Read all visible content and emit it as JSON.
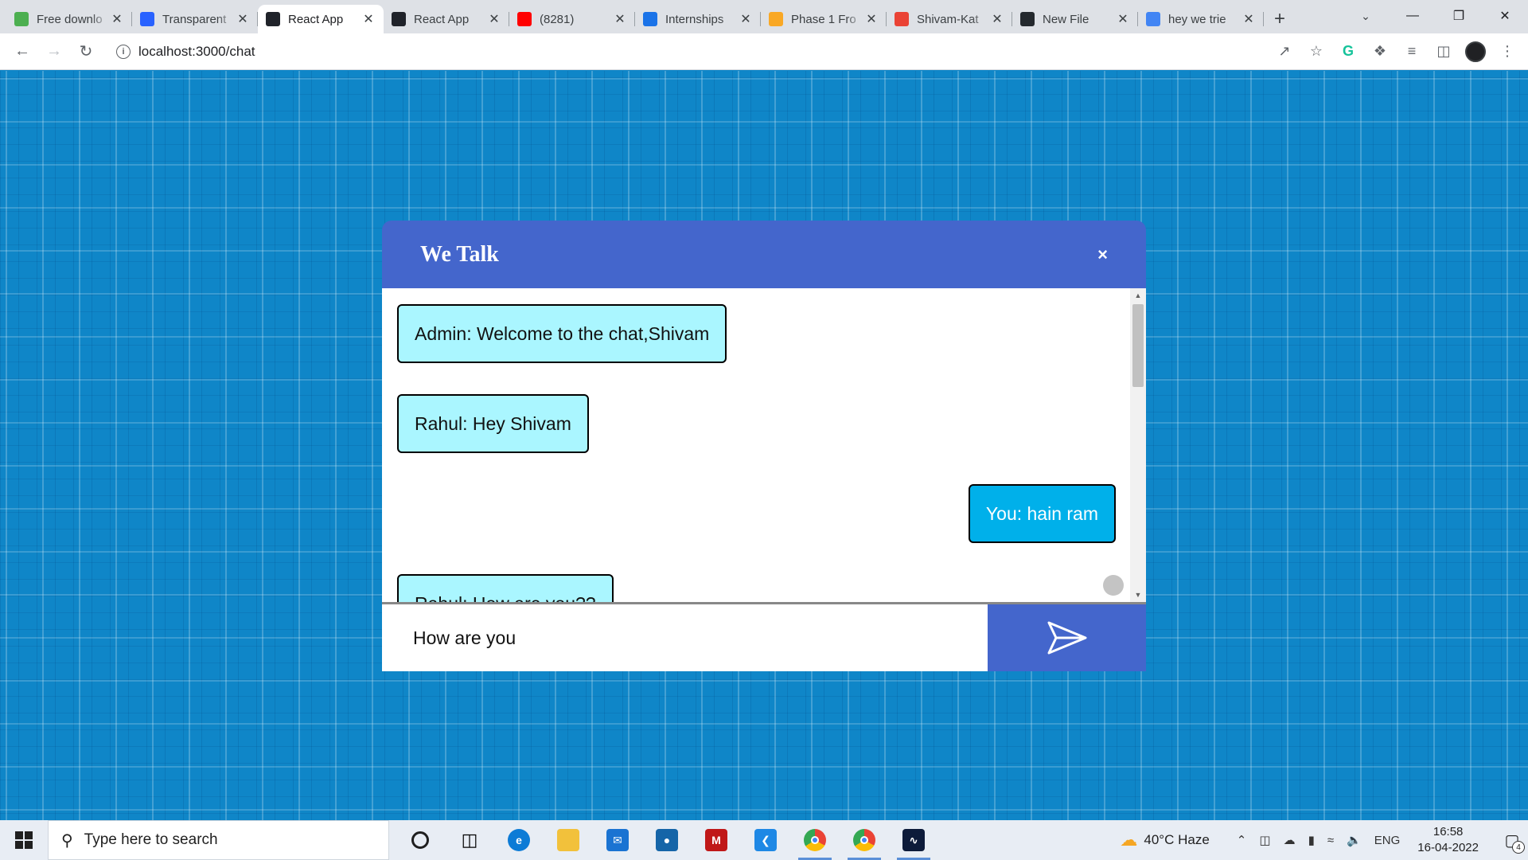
{
  "browser": {
    "tabs": [
      {
        "title": "Free downlo",
        "favicon": "leaf-icon",
        "color": "#4caf50"
      },
      {
        "title": "Transparent",
        "favicon": "tt-icon",
        "color": "#2962ff"
      },
      {
        "title": "React App",
        "favicon": "react-icon",
        "color": "#20232a",
        "active": true
      },
      {
        "title": "React App",
        "favicon": "react-icon",
        "color": "#20232a"
      },
      {
        "title": "(8281)",
        "favicon": "youtube-icon",
        "color": "#ff0000"
      },
      {
        "title": "Internships",
        "favicon": "internshala-icon",
        "color": "#1a73e8"
      },
      {
        "title": "Phase 1 Fro",
        "favicon": "sun-icon",
        "color": "#f9a825"
      },
      {
        "title": "Shivam-Kat",
        "favicon": "gmail-icon",
        "color": "#ea4335"
      },
      {
        "title": "New File",
        "favicon": "github-icon",
        "color": "#24292e"
      },
      {
        "title": "hey we trie",
        "favicon": "google-icon",
        "color": "#4285f4"
      }
    ],
    "url": "localhost:3000/chat"
  },
  "chat": {
    "title": "We Talk",
    "close_label": "×",
    "messages": [
      {
        "text": "Admin: Welcome to the chat,Shivam",
        "sender": "other"
      },
      {
        "text": "Rahul: Hey Shivam",
        "sender": "other"
      },
      {
        "text": "You: hain ram",
        "sender": "you"
      },
      {
        "text": "Rahul: How are you??",
        "sender": "other"
      }
    ],
    "input_value": "How are you",
    "colors": {
      "header": "#4466cc",
      "message_other": "#aaf6ff",
      "message_you": "#00b0ea"
    }
  },
  "taskbar": {
    "search_placeholder": "Type here to search",
    "apps": [
      "cortana-icon",
      "task-view-icon",
      "edge-icon",
      "file-explorer-icon",
      "mail-icon",
      "dell-icon",
      "mcafee-icon",
      "vscode-icon",
      "chrome-icon",
      "chrome-icon",
      "app-icon"
    ],
    "weather": "40°C  Haze",
    "language": "ENG",
    "time": "16:58",
    "date": "16-04-2022",
    "notification_count": "4"
  }
}
